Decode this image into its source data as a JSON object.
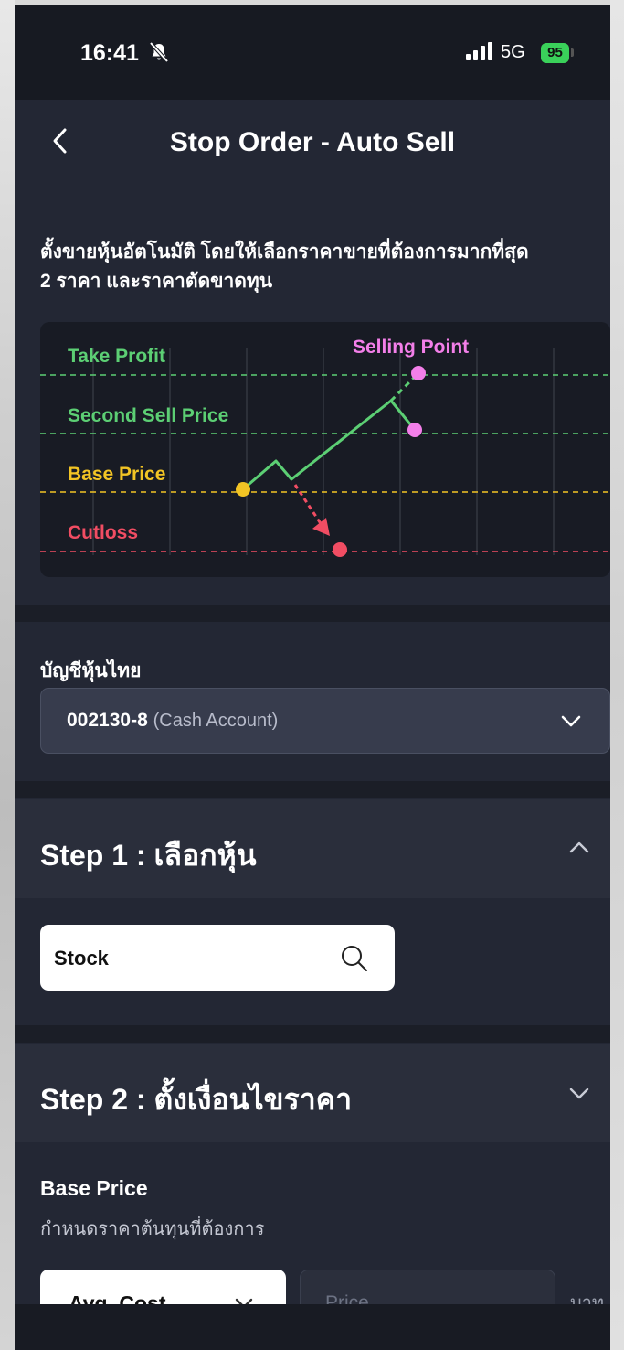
{
  "status_bar": {
    "time": "16:41",
    "network": "5G",
    "battery": "95",
    "icons": [
      "bell-slash-icon",
      "signal-icon",
      "battery-icon"
    ]
  },
  "header": {
    "title": "Stop Order - Auto Sell",
    "back_icon": "chevron-left-icon"
  },
  "description": {
    "line1": "ตั้งขายหุ้นอัตโนมัติ โดยให้เลือกราคาขายที่ต้องการมากที่สุด",
    "line2": "2 ราคา และราคาตัดขาดทุน"
  },
  "diagram": {
    "labels": {
      "take_profit": "Take Profit",
      "second_sell": "Second Sell Price",
      "base_price": "Base Price",
      "cutloss": "Cutloss",
      "selling_point": "Selling Point"
    },
    "colors": {
      "take_profit": "#5ccf74",
      "base_price": "#f2c424",
      "cutloss": "#f14d63",
      "selling_point": "#f37fe9",
      "background": "#181b24"
    }
  },
  "account": {
    "label": "บัญชีหุ้นไทย",
    "number": "002130-8",
    "type": "(Cash Account)",
    "icon": "chevron-down-icon"
  },
  "step1": {
    "title": "Step 1 : เลือกหุ้น",
    "icon": "chevron-up-icon",
    "stock_label": "Stock",
    "search_icon": "search-icon"
  },
  "step2": {
    "title": "Step 2 : ตั้งเงื่อนไขราคา",
    "icon": "chevron-down-icon",
    "base_price_title": "Base Price",
    "base_price_sub": "กำหนดราคาต้นทุนที่ต้องการ",
    "avg_cost_label": "Avg. Cost",
    "price_placeholder": "Price",
    "unit": "บาท"
  },
  "colors": {
    "background": "#232734",
    "panel": "#2a2e3b",
    "status_bar": "#171a22"
  }
}
